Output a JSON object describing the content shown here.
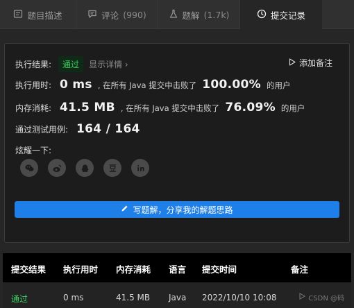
{
  "tabs": [
    {
      "label": "题目描述",
      "icon": "document-icon"
    },
    {
      "label": "评论",
      "count": "(990)",
      "icon": "comment-icon"
    },
    {
      "label": "题解",
      "count": "(1.7k)",
      "icon": "flask-icon"
    },
    {
      "label": "提交记录",
      "icon": "clock-icon",
      "active": true
    }
  ],
  "result": {
    "status_label": "执行结果:",
    "status": "通过",
    "detail_link": "显示详情 ›",
    "add_note": "添加备注",
    "runtime_label": "执行用时:",
    "runtime_value": "0 ms",
    "runtime_text": ", 在所有 Java 提交中击败了",
    "runtime_percent": "100.00%",
    "runtime_suffix": "的用户",
    "memory_label": "内存消耗:",
    "memory_value": "41.5 MB",
    "memory_text": ", 在所有 Java 提交中击败了",
    "memory_percent": "76.09%",
    "memory_suffix": "的用户",
    "tests_label": "通过测试用例:",
    "tests_value": "164 / 164",
    "share_label": "炫耀一下:",
    "share_icons": [
      "wechat-icon",
      "weibo-icon",
      "qq-icon",
      "douban-icon",
      "linkedin-icon"
    ],
    "write_button": "写题解，分享我的解题思路"
  },
  "table": {
    "headers": [
      "提交结果",
      "执行用时",
      "内存消耗",
      "语言",
      "提交时间",
      "备注"
    ],
    "rows": [
      {
        "result": "通过",
        "runtime": "0 ms",
        "memory": "41.5 MB",
        "language": "Java",
        "time": "2022/10/10 10:08"
      }
    ],
    "watermark": "CSDN @码"
  },
  "colors": {
    "accent": "#1e7fe8",
    "success": "#3fcf62",
    "background": "#262626"
  }
}
